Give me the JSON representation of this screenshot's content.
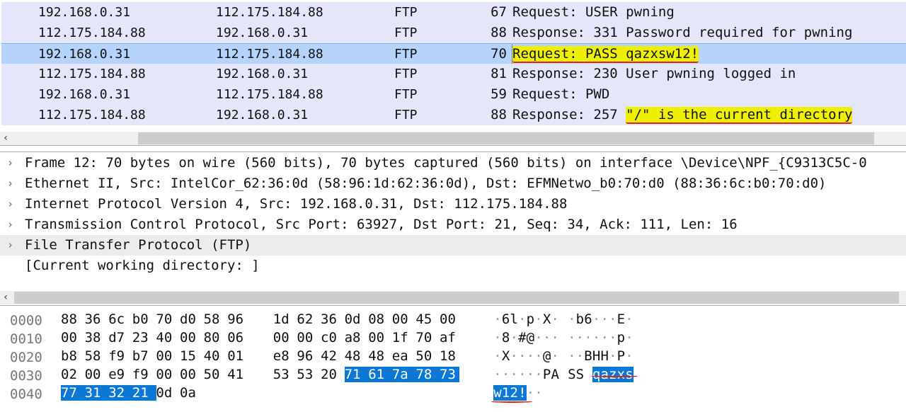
{
  "packet_list": {
    "rows": [
      {
        "source": "192.168.0.31",
        "destination": "112.175.184.88",
        "protocol": "FTP",
        "length": "67",
        "info": "Request: USER pwning"
      },
      {
        "source": "112.175.184.88",
        "destination": "192.168.0.31",
        "protocol": "FTP",
        "length": "88",
        "info": "Response: 331 Password required for pwning"
      },
      {
        "source": "192.168.0.31",
        "destination": "112.175.184.88",
        "protocol": "FTP",
        "length": "70",
        "info": "Request: PASS qazxsw12!",
        "selected": true
      },
      {
        "source": "112.175.184.88",
        "destination": "192.168.0.31",
        "protocol": "FTP",
        "length": "81",
        "info": "Response: 230 User pwning logged in"
      },
      {
        "source": "192.168.0.31",
        "destination": "112.175.184.88",
        "protocol": "FTP",
        "length": "59",
        "info": "Request: PWD"
      },
      {
        "source": "112.175.184.88",
        "destination": "192.168.0.31",
        "protocol": "FTP",
        "length": "88",
        "info_prefix": "Response: 257 ",
        "info_highlight": "\"/\" is the current directory"
      }
    ],
    "selected_color": "#b6d4fb",
    "row_color": "#e6e6fa",
    "highlight_color": "#eef000"
  },
  "details": {
    "rows": [
      {
        "expander": "›",
        "text": "Frame 12: 70 bytes on wire (560 bits), 70 bytes captured (560 bits) on interface \\Device\\NPF_{C9313C5C-0"
      },
      {
        "expander": "›",
        "text": "Ethernet II, Src: IntelCor_62:36:0d (58:96:1d:62:36:0d), Dst: EFMNetwo_b0:70:d0 (88:36:6c:b0:70:d0)"
      },
      {
        "expander": "›",
        "text": "Internet Protocol Version 4, Src: 192.168.0.31, Dst: 112.175.184.88"
      },
      {
        "expander": "›",
        "text": "Transmission Control Protocol, Src Port: 63927, Dst Port: 21, Seq: 34, Ack: 111, Len: 16"
      },
      {
        "expander": "›",
        "text": "File Transfer Protocol (FTP)"
      },
      {
        "expander": "",
        "text": "[Current working directory: ]"
      }
    ]
  },
  "hex": {
    "rows": [
      {
        "offset": "0000",
        "bytes": [
          "88",
          "36",
          "6c",
          "b0",
          "70",
          "d0",
          "58",
          "96",
          "1d",
          "62",
          "36",
          "0d",
          "08",
          "00",
          "45",
          "00"
        ]
      },
      {
        "offset": "0010",
        "bytes": [
          "00",
          "38",
          "d7",
          "23",
          "40",
          "00",
          "80",
          "06",
          "00",
          "00",
          "c0",
          "a8",
          "00",
          "1f",
          "70",
          "af"
        ]
      },
      {
        "offset": "0020",
        "bytes": [
          "b8",
          "58",
          "f9",
          "b7",
          "00",
          "15",
          "40",
          "01",
          "e8",
          "96",
          "42",
          "48",
          "48",
          "ea",
          "50",
          "18"
        ]
      },
      {
        "offset": "0030",
        "bytes": [
          "02",
          "00",
          "e9",
          "f9",
          "00",
          "00",
          "50",
          "41",
          "53",
          "53",
          "20",
          "71",
          "61",
          "7a",
          "78",
          "73"
        ]
      },
      {
        "offset": "0040",
        "bytes": [
          "77",
          "31",
          "32",
          "21",
          "0d",
          "0a"
        ]
      }
    ],
    "selection_color": "#0a78d4"
  },
  "icons": {
    "scroll_left": "‹"
  }
}
